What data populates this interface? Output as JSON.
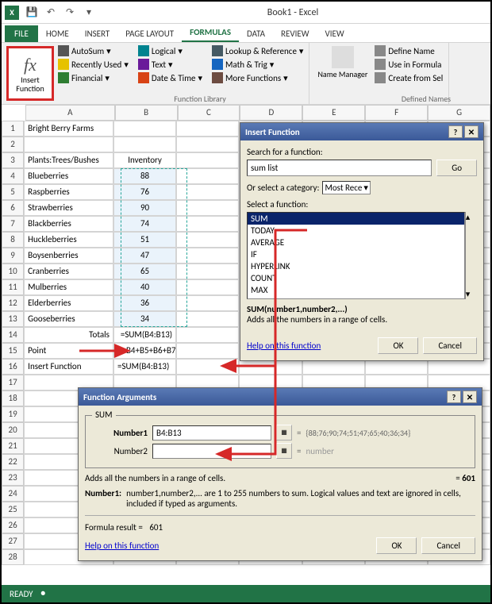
{
  "titlebar": {
    "app_title": "Book1 - Excel"
  },
  "tabs": [
    "FILE",
    "HOME",
    "INSERT",
    "PAGE LAYOUT",
    "FORMULAS",
    "DATA",
    "REVIEW",
    "VIEW"
  ],
  "active_tab": 4,
  "ribbon": {
    "insert_function": "Insert Function",
    "autosum": "AutoSum",
    "recently": "Recently Used",
    "financial": "Financial",
    "logical": "Logical",
    "text": "Text",
    "datetime": "Date & Time",
    "lookup": "Lookup & Reference",
    "math": "Math & Trig",
    "more": "More Functions",
    "group1": "Function Library",
    "name_mgr": "Name Manager",
    "define": "Define Name",
    "usein": "Use in Formula",
    "create": "Create from Sel",
    "group2": "Defined Names"
  },
  "columns": [
    "A",
    "B",
    "C",
    "D",
    "E",
    "F",
    "G"
  ],
  "cells": {
    "a1": "Bright Berry Farms",
    "a3": "Plants:Trees/Bushes",
    "b3": "Inventory",
    "a4": "Blueberries",
    "b4": "88",
    "a5": "Raspberries",
    "b5": "76",
    "a6": "Strawberries",
    "b6": "90",
    "a7": "Blackberries",
    "b7": "74",
    "a8": "Huckleberries",
    "b8": "51",
    "a9": "Boysenberries",
    "b9": "47",
    "a10": "Cranberries",
    "b10": "65",
    "a11": "Mulberries",
    "b11": "40",
    "a12": "Elderberries",
    "b12": "36",
    "a13": "Gooseberries",
    "b13": "34",
    "a14": "Totals",
    "b14": "=SUM(B4:B13)",
    "a15": "Point",
    "b15": "=+B4+B5+B6+B7",
    "a16": "Insert Function",
    "b16": "=SUM(B4:B13)"
  },
  "rowcount": 28,
  "insert_dialog": {
    "title": "Insert Function",
    "search_label": "Search for a function:",
    "search_value": "sum list",
    "go": "Go",
    "cat_label": "Or select a category:",
    "cat_value": "Most Rece",
    "select_label": "Select a function:",
    "functions": [
      "SUM",
      "TODAY",
      "AVERAGE",
      "IF",
      "HYPERLINK",
      "COUNT",
      "MAX"
    ],
    "syntax": "SUM(number1,number2,...)",
    "desc": "Adds all the numbers in a range of cells.",
    "help": "Help on this function",
    "ok": "OK",
    "cancel": "Cancel"
  },
  "args_dialog": {
    "title": "Function Arguments",
    "fn": "SUM",
    "n1_label": "Number1",
    "n1_value": "B4:B13",
    "n1_result": "{88;76;90;74;51;47;65;40;36;34}",
    "n2_label": "Number2",
    "n2_value": "",
    "n2_hint": "number",
    "desc": "Adds all the numbers in a range of cells.",
    "result_eq": "601",
    "argdesc_label": "Number1:",
    "argdesc": "number1,number2,... are 1 to 255 numbers to sum. Logical values and text are ignored in cells, included if typed as arguments.",
    "formula_result": "Formula result =",
    "formula_value": "601",
    "help": "Help on this function",
    "ok": "OK",
    "cancel": "Cancel"
  },
  "status": "READY"
}
